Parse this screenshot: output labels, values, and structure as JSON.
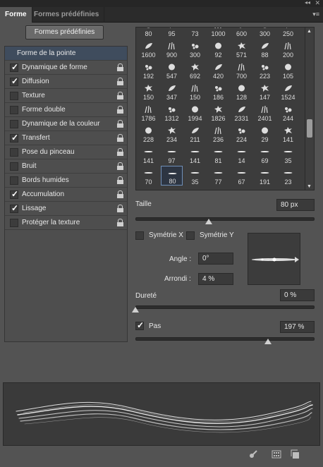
{
  "tabs": {
    "active": "Forme",
    "inactive": "Formes prédéfinies",
    "menu_icon": "panel-menu-icon"
  },
  "preset_button": "Formes prédéfinies",
  "options": [
    {
      "label": "Forme de la pointe",
      "header": true
    },
    {
      "label": "Dynamique de forme",
      "checked": true,
      "lock": true
    },
    {
      "label": "Diffusion",
      "checked": true,
      "lock": true
    },
    {
      "label": "Texture",
      "checked": false,
      "lock": true
    },
    {
      "label": "Forme double",
      "checked": false,
      "lock": true
    },
    {
      "label": "Dynamique de la couleur",
      "checked": false,
      "lock": true
    },
    {
      "label": "Transfert",
      "checked": true,
      "lock": true
    },
    {
      "label": "Pose du pinceau",
      "checked": false,
      "lock": true
    },
    {
      "label": "Bruit",
      "checked": false,
      "lock": true
    },
    {
      "label": "Bords humides",
      "checked": false,
      "lock": true
    },
    {
      "label": "Accumulation",
      "checked": true,
      "lock": true
    },
    {
      "label": "Lissage",
      "checked": true,
      "lock": true
    },
    {
      "label": "Protéger la texture",
      "checked": false,
      "lock": true
    }
  ],
  "brushes": [
    [
      "80",
      "95",
      "73",
      "1000",
      "600",
      "300",
      "250"
    ],
    [
      "1600",
      "900",
      "300",
      "92",
      "571",
      "88",
      "200"
    ],
    [
      "192",
      "547",
      "692",
      "420",
      "700",
      "223",
      "105"
    ],
    [
      "150",
      "347",
      "150",
      "186",
      "128",
      "147",
      "1524"
    ],
    [
      "1786",
      "1312",
      "1994",
      "1826",
      "2331",
      "2401",
      "244"
    ],
    [
      "228",
      "234",
      "211",
      "236",
      "224",
      "29",
      "141"
    ],
    [
      "141",
      "97",
      "141",
      "81",
      "14",
      "69",
      "35"
    ],
    [
      "70",
      "80",
      "35",
      "77",
      "67",
      "191",
      "23"
    ]
  ],
  "selected_brush": "80",
  "size": {
    "label": "Taille",
    "value": "80 px",
    "level": 0.41
  },
  "flip": {
    "x_label": "Symétrie X",
    "y_label": "Symétrie Y"
  },
  "angle": {
    "label": "Angle :",
    "value": "0°"
  },
  "roundness": {
    "label": "Arrondi :",
    "value": "4 %"
  },
  "hardness": {
    "label": "Dureté",
    "value": "0 %",
    "level": 0.0
  },
  "spacing": {
    "label": "Pas",
    "value": "197 %",
    "checked": true,
    "level": 0.74
  }
}
